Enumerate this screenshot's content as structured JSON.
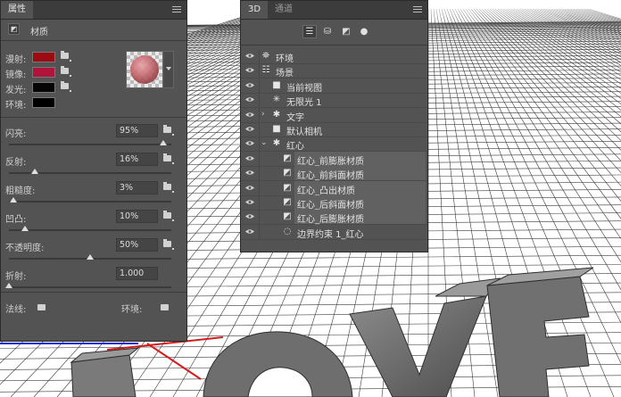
{
  "properties_panel": {
    "tab": "属性",
    "section_label": "材质",
    "colors": [
      {
        "label": "漫射:",
        "swatch": "#9c0a12"
      },
      {
        "label": "镜像:",
        "swatch": "#b0143a"
      },
      {
        "label": "发光:",
        "swatch": "#050505"
      },
      {
        "label": "环境:",
        "swatch": "#000000"
      }
    ],
    "sliders": [
      {
        "label": "闪亮:",
        "value": "95%",
        "level": 0.95
      },
      {
        "label": "反射:",
        "value": "16%",
        "level": 0.16
      },
      {
        "label": "粗糙度:",
        "value": "3%",
        "level": 0.03
      },
      {
        "label": "凹凸:",
        "value": "10%",
        "level": 0.1
      },
      {
        "label": "不透明度:",
        "value": "50%",
        "level": 0.5
      },
      {
        "label": "折射:",
        "value": "1.000",
        "level": 0.0
      }
    ],
    "normal_label": "法线:",
    "environment_label": "环境:"
  },
  "panel_3d": {
    "tab_active": "3D",
    "tab_inactive": "通道",
    "layers": [
      {
        "name": "环境",
        "icon": "environment-icon",
        "level": 0,
        "highlight": false
      },
      {
        "name": "场景",
        "icon": "scene-icon",
        "level": 0,
        "highlight": false
      },
      {
        "name": "当前视图",
        "icon": "camera-icon",
        "level": 1,
        "highlight": false
      },
      {
        "name": "无限光 1",
        "icon": "light-icon",
        "level": 1,
        "highlight": false
      },
      {
        "name": "文字",
        "icon": "mesh-icon",
        "level": 1,
        "highlight": false,
        "collapsed": true
      },
      {
        "name": "默认相机",
        "icon": "camera-icon",
        "level": 1,
        "highlight": false
      },
      {
        "name": "红心",
        "icon": "mesh-icon",
        "level": 1,
        "highlight": false,
        "expanded": true
      },
      {
        "name": "红心_前膨胀材质",
        "icon": "material-icon",
        "level": 2,
        "highlight": true
      },
      {
        "name": "红心_前斜面材质",
        "icon": "material-icon",
        "level": 2,
        "highlight": true
      },
      {
        "name": "红心_凸出材质",
        "icon": "material-icon",
        "level": 2,
        "highlight": true
      },
      {
        "name": "红心_后斜面材质",
        "icon": "material-icon",
        "level": 2,
        "highlight": true
      },
      {
        "name": "红心_后膨胀材质",
        "icon": "material-icon",
        "level": 2,
        "highlight": true
      },
      {
        "name": "边界约束 1_红心",
        "icon": "constraint-icon",
        "level": 2,
        "highlight": false
      }
    ]
  }
}
